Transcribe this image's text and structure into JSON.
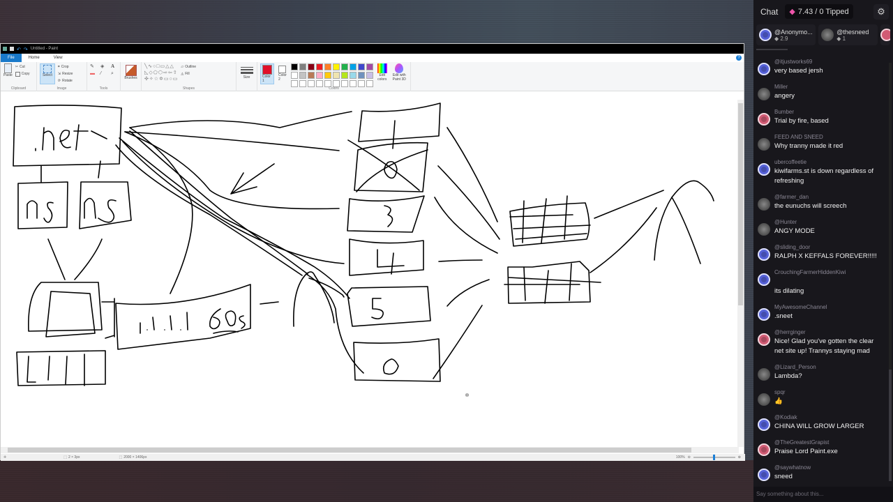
{
  "paint": {
    "window_title": "Untitled - Paint",
    "tabs": [
      {
        "label": "File"
      },
      {
        "label": "Home"
      },
      {
        "label": "View"
      }
    ],
    "clipboard": {
      "paste": "Paste",
      "cut": "Cut",
      "copy": "Copy",
      "label": "Clipboard"
    },
    "image": {
      "select": "Select",
      "crop": "Crop",
      "resize": "Resize",
      "rotate": "Rotate",
      "label": "Image"
    },
    "tools": {
      "label": "Tools"
    },
    "brushes": {
      "label": "Brushes"
    },
    "shapes": {
      "outline": "Outline",
      "fill": "Fill",
      "label": "Shapes"
    },
    "size": {
      "label": "Size"
    },
    "colors": {
      "color1_label": "Color 1",
      "color2_label": "Color 2",
      "edit_colors": "Edit colors",
      "edit_paint3d": "Edit with Paint 3D",
      "label": "Colors",
      "color1": "#e0102a",
      "color2": "#ffffff",
      "palette_row1": [
        "#000000",
        "#7f7f7f",
        "#880015",
        "#ed1c24",
        "#ff7f27",
        "#fff200",
        "#22b14c",
        "#00a2e8",
        "#3f48cc",
        "#a349a4"
      ],
      "palette_row2": [
        "#ffffff",
        "#c3c3c3",
        "#b97a57",
        "#ffaec9",
        "#ffc90e",
        "#efe4b0",
        "#b5e61d",
        "#99d9ea",
        "#7092be",
        "#c8bfe7"
      ]
    },
    "status": {
      "selection": "2 × 3px",
      "image_size": "2000 × 1406px",
      "zoom": "100%"
    },
    "drawing_labels": {
      "net": ".net",
      "ns1": "ns",
      "ns2": "ns",
      "ip": "1.1.1.1",
      "ttl": "60s",
      "boxes": [
        "1",
        "3",
        "4",
        "5",
        "6"
      ]
    }
  },
  "chat": {
    "title": "Chat",
    "tipped": "7.43 / 0 Tipped",
    "tippers": [
      {
        "name": "@Anonymo...",
        "amount": "2.9",
        "avatar": "blue"
      },
      {
        "name": "@thesneed",
        "amount": "1",
        "avatar": "img"
      }
    ],
    "messages": [
      {
        "user": "@itjustworks69",
        "text": "very based jersh",
        "avatar": "blue"
      },
      {
        "user": "Miller",
        "text": "angery",
        "avatar": "img"
      },
      {
        "user": "Bumber",
        "text": "Trial by fire, based",
        "avatar": "red"
      },
      {
        "user": "FEED AND SNEED",
        "text": "Why tranny made it red",
        "avatar": "img"
      },
      {
        "user": "ubercoffeetie",
        "text": "kiwifarms.st is down regardless of refreshing",
        "avatar": "blue"
      },
      {
        "user": "@farmer_dan",
        "text": "the eunuchs will screech",
        "avatar": "img"
      },
      {
        "user": "@Hunter",
        "text": "ANGY MODE",
        "avatar": "img"
      },
      {
        "user": "@sliding_door",
        "text": "RALPH X KEFFALS FOREVER!!!!!",
        "avatar": "blue"
      },
      {
        "user": "CrouchingFarmerHiddenKiwi",
        "text": "its dilating",
        "avatar": "blue"
      },
      {
        "user": "MyAwesomeChannel",
        "text": ".sneet",
        "avatar": "blue"
      },
      {
        "user": "@herrginger",
        "text": "Nice! Glad you've gotten the clear net site up! Trannys staying mad",
        "avatar": "red"
      },
      {
        "user": "@Lizard_Person",
        "text": "Lambda?",
        "avatar": "img"
      },
      {
        "user": "spqr",
        "text": "👍",
        "avatar": "img"
      },
      {
        "user": "@Kodiak",
        "text": "CHINA WILL GROW LARGER",
        "avatar": "blue"
      },
      {
        "user": "@TheGreatestGrapist",
        "text": "Praise Lord Paint.exe",
        "avatar": "red"
      },
      {
        "user": "@saywhatnow",
        "text": "sneed",
        "avatar": "blue"
      }
    ],
    "input_placeholder": "Say something about this..."
  }
}
